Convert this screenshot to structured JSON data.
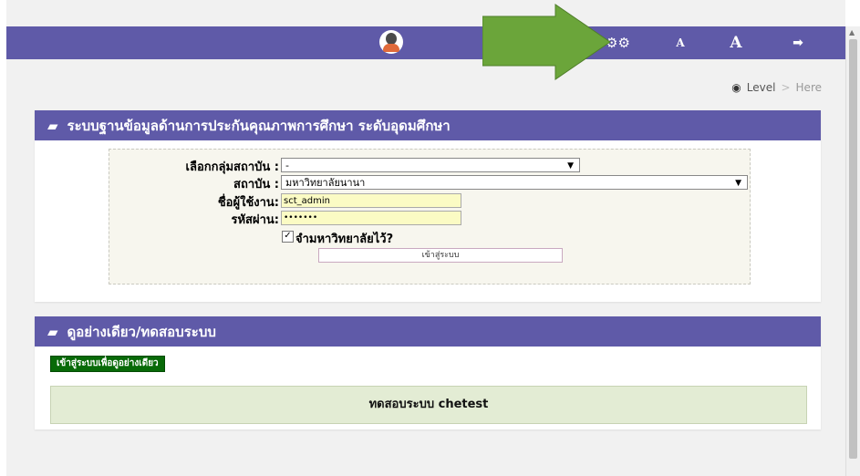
{
  "topbar": {
    "avatar_icon": "user-avatar-icon",
    "settings_icon": "⚙⚙",
    "font_small_label": "A",
    "font_large_label": "A",
    "logout_icon": "➡"
  },
  "breadcrumb": {
    "icon": "dashboard-icon",
    "level": "Level",
    "separator": ">",
    "here": "Here"
  },
  "login_card": {
    "title": "ระบบฐานข้อมูลด้านการประกันคุณภาพการศึกษา ระดับอุดมศึกษา",
    "institution_group_label": "เลือกกลุ่มสถาบัน :",
    "institution_group_value": "-",
    "institution_label": "สถาบัน :",
    "institution_value": "มหาวิทยาลัยนานา",
    "username_label": "ชื่อผู้ใช้งาน:",
    "username_value": "sct_admin",
    "password_label": "รหัสผ่าน:",
    "password_value": "•••••••",
    "remember_label": "จำมหาวิทยาลัยไว้?",
    "login_button": "เข้าสู่ระบบ"
  },
  "demo_card": {
    "title": "ดูอย่างเดียว/ทดสอบระบบ",
    "view_only_button": "เข้าสู่ระบบเพื่อดูอย่างเดียว",
    "test_system_text": "ทดสอบระบบ chetest"
  },
  "colors": {
    "header_bg": "#5f5aa8",
    "arrow": "#6ba53a",
    "green_button": "#086a08",
    "test_box": "#e3ecd4"
  }
}
